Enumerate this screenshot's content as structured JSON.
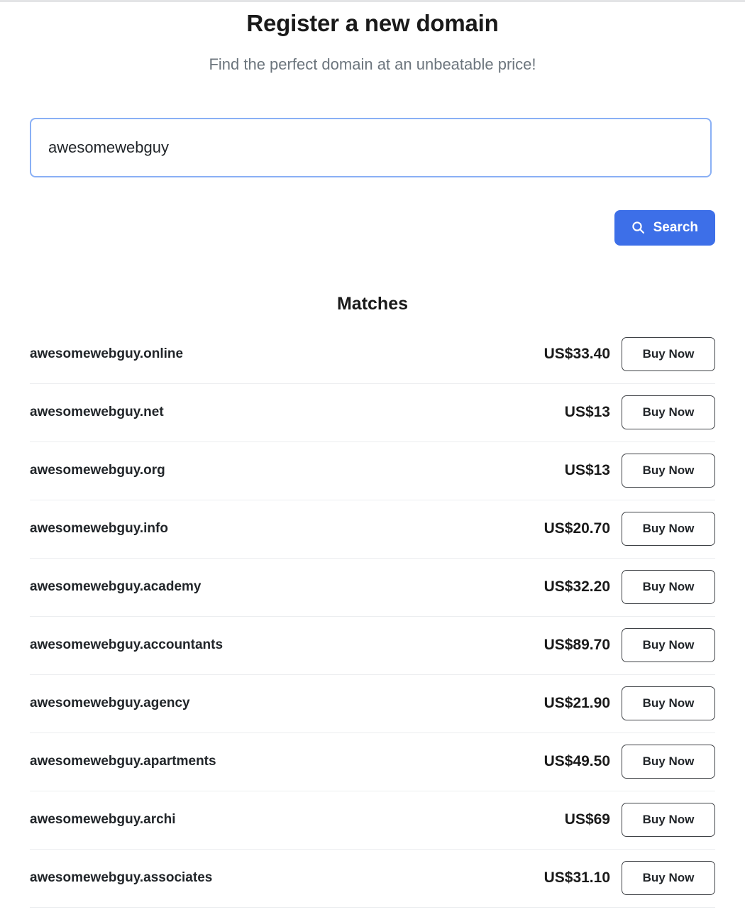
{
  "page": {
    "title": "Register a new domain",
    "subtitle": "Find the perfect domain at an unbeatable price!"
  },
  "search": {
    "value": "awesomewebguy",
    "placeholder": "",
    "button_label": "Search",
    "icon": "search-icon",
    "button_color": "#3d6fe8",
    "input_border_color": "#8ab0f5"
  },
  "results": {
    "heading": "Matches",
    "buy_label": "Buy Now",
    "rows": [
      {
        "domain": "awesomewebguy.online",
        "price": "US$33.40"
      },
      {
        "domain": "awesomewebguy.net",
        "price": "US$13"
      },
      {
        "domain": "awesomewebguy.org",
        "price": "US$13"
      },
      {
        "domain": "awesomewebguy.info",
        "price": "US$20.70"
      },
      {
        "domain": "awesomewebguy.academy",
        "price": "US$32.20"
      },
      {
        "domain": "awesomewebguy.accountants",
        "price": "US$89.70"
      },
      {
        "domain": "awesomewebguy.agency",
        "price": "US$21.90"
      },
      {
        "domain": "awesomewebguy.apartments",
        "price": "US$49.50"
      },
      {
        "domain": "awesomewebguy.archi",
        "price": "US$69"
      },
      {
        "domain": "awesomewebguy.associates",
        "price": "US$31.10"
      }
    ]
  }
}
